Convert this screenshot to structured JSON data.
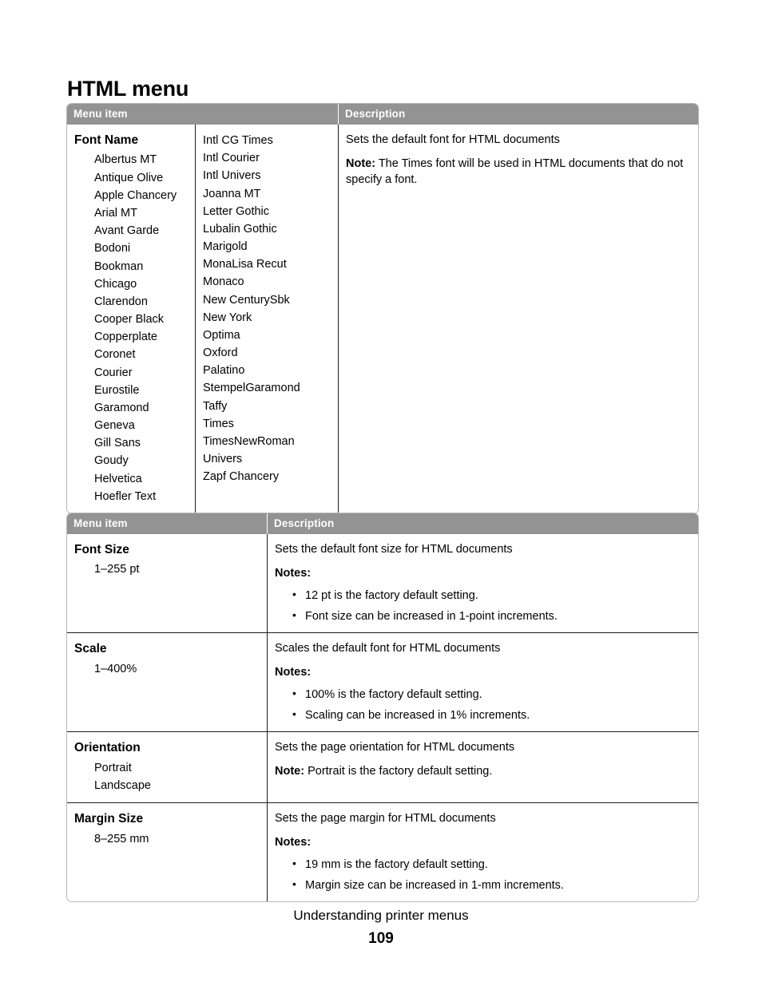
{
  "document": {
    "heading": "HTML menu",
    "footer": {
      "section_title": "Understanding printer menus",
      "page_number": "109"
    },
    "colors": {
      "header_fill": "#939393",
      "header_text": "#ffffff",
      "rule": "#1c1c1c",
      "outer_border": "#b8b8b8",
      "text": "#000000"
    }
  },
  "tables": {
    "font_name": {
      "headers": {
        "menu_item": "Menu item",
        "description": "Description"
      },
      "row": {
        "menu_title": "Font Name",
        "fonts_column_1": [
          "Albertus MT",
          "Antique Olive",
          "Apple Chancery",
          "Arial MT",
          "Avant Garde",
          "Bodoni",
          "Bookman",
          "Chicago",
          "Clarendon",
          "Cooper Black",
          "Copperplate",
          "Coronet",
          "Courier",
          "Eurostile",
          "Garamond",
          "Geneva",
          "Gill Sans",
          "Goudy",
          "Helvetica",
          "Hoefler Text"
        ],
        "fonts_column_2": [
          "Intl CG Times",
          "Intl Courier",
          "Intl Univers",
          "Joanna MT",
          "Letter Gothic",
          "Lubalin Gothic",
          "Marigold",
          "MonaLisa Recut",
          "Monaco",
          "New CenturySbk",
          "New York",
          "Optima",
          "Oxford",
          "Palatino",
          "StempelGaramond",
          "Taffy",
          "Times",
          "TimesNewRoman",
          "Univers",
          "Zapf Chancery"
        ],
        "description_main": "Sets the default font for HTML documents",
        "note_label": "Note:",
        "note_text": " The Times font will be used in HTML documents that do not specify a font."
      }
    },
    "properties": {
      "headers": {
        "menu_item": "Menu item",
        "description": "Description"
      },
      "rows": [
        {
          "menu_title": "Font Size",
          "values": [
            "1–255 pt"
          ],
          "description_main": "Sets the default font size for HTML documents",
          "notes_label": "Notes:",
          "notes": [
            "12 pt is the factory default setting.",
            "Font size can be increased in 1-point increments."
          ]
        },
        {
          "menu_title": "Scale",
          "values": [
            "1–400%"
          ],
          "description_main": "Scales the default font for HTML documents",
          "notes_label": "Notes:",
          "notes": [
            "100% is the factory default setting.",
            "Scaling can be increased in 1% increments."
          ]
        },
        {
          "menu_title": "Orientation",
          "values": [
            "Portrait",
            "Landscape"
          ],
          "description_main": "Sets the page orientation for HTML documents",
          "note_label": "Note:",
          "note_text": " Portrait is the factory default setting.",
          "notes": []
        },
        {
          "menu_title": "Margin Size",
          "values": [
            "8–255 mm"
          ],
          "description_main": "Sets the page margin for HTML documents",
          "notes_label": "Notes:",
          "notes": [
            "19 mm is the factory default setting.",
            "Margin size can be increased in 1-mm increments."
          ]
        }
      ]
    }
  }
}
